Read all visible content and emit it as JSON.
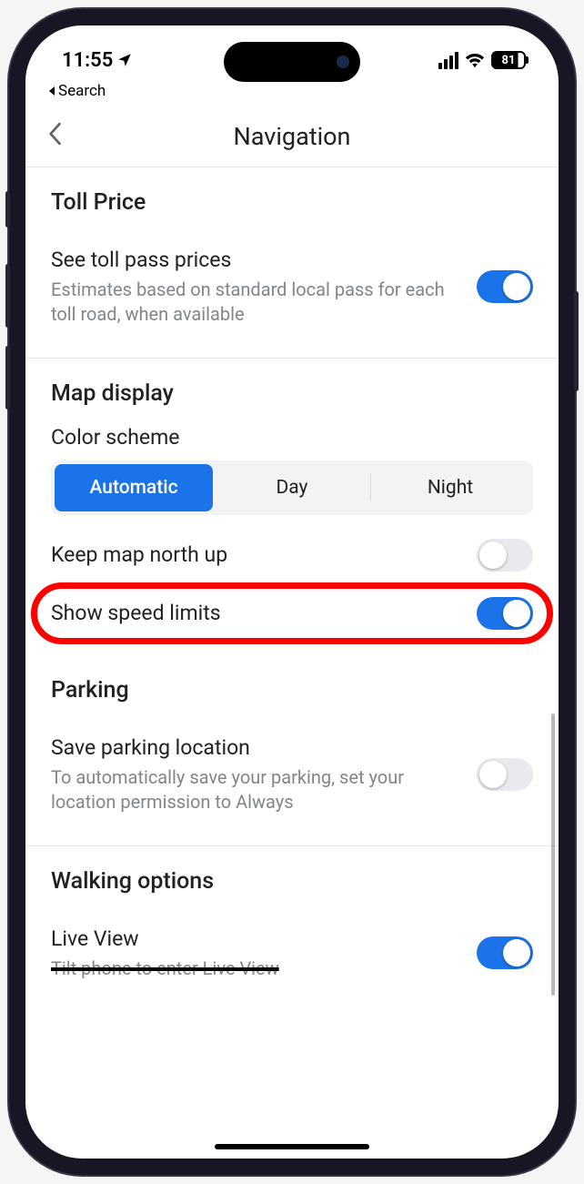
{
  "statusbar": {
    "time": "11:55",
    "battery": "81"
  },
  "breadcrumb": {
    "label": "Search"
  },
  "header": {
    "title": "Navigation"
  },
  "sections": {
    "toll": {
      "title": "Toll Price",
      "see_prices": {
        "label": "See toll pass prices",
        "sub": "Estimates based on standard local pass for each toll road, when available"
      }
    },
    "map_display": {
      "title": "Map display",
      "color_scheme_label": "Color scheme",
      "segments": {
        "auto": "Automatic",
        "day": "Day",
        "night": "Night"
      },
      "keep_north": {
        "label": "Keep map north up"
      },
      "speed_limits": {
        "label": "Show speed limits"
      }
    },
    "parking": {
      "title": "Parking",
      "save_location": {
        "label": "Save parking location",
        "sub": "To automatically save your parking, set your location permission to Always"
      }
    },
    "walking": {
      "title": "Walking options",
      "live_view": {
        "label": "Live View",
        "sub": "Tilt phone to enter Live View"
      }
    }
  },
  "toggles": {
    "see_toll_prices": true,
    "keep_north": false,
    "speed_limits": true,
    "save_parking": false,
    "live_view": true
  }
}
